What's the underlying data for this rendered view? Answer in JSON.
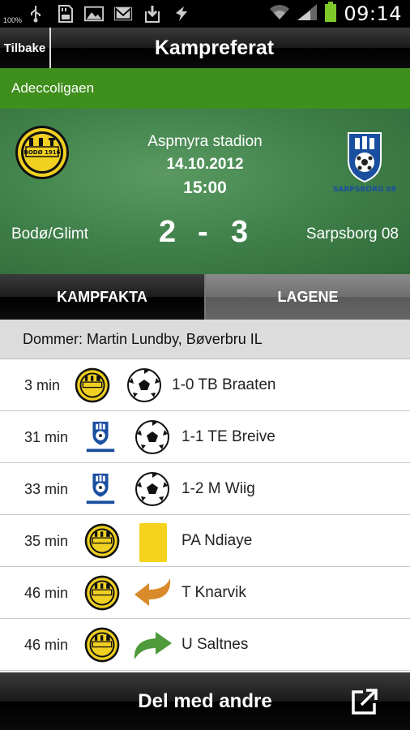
{
  "status_bar": {
    "battery_small_text": "100%",
    "time": "09:14",
    "icons": [
      "usb-icon",
      "sd-card-icon",
      "image-icon",
      "gmail-icon",
      "download-icon",
      "sync-icon",
      "wifi-icon",
      "signal-icon",
      "battery-icon"
    ]
  },
  "header": {
    "back_label": "Tilbake",
    "title": "Kampreferat"
  },
  "league": "Adeccoligaen",
  "match": {
    "venue": "Aspmyra stadion",
    "date": "14.10.2012",
    "time": "15:00",
    "home_team": "Bodø/Glimt",
    "away_team": "Sarpsborg 08",
    "home_score": "2",
    "separator": "-",
    "away_score": "3",
    "home_logo_text": "BODØ 1916",
    "away_logo_text": "SARPSBORG 08"
  },
  "tabs": [
    {
      "label": "KAMPFAKTA",
      "active": true
    },
    {
      "label": "LAGENE",
      "active": false
    }
  ],
  "referee": "Dommer: Martin Lundby, Bøverbru IL",
  "events": [
    {
      "minute": "3 min",
      "team": "home",
      "type": "goal",
      "text": "1-0 TB Braaten"
    },
    {
      "minute": "31 min",
      "team": "away",
      "type": "goal",
      "text": "1-1 TE Breive"
    },
    {
      "minute": "33 min",
      "team": "away",
      "type": "goal",
      "text": "1-2 M Wiig"
    },
    {
      "minute": "35 min",
      "team": "home",
      "type": "yellow-card",
      "text": "PA Ndiaye"
    },
    {
      "minute": "46 min",
      "team": "home",
      "type": "substitution-out",
      "text": "T Knarvik"
    },
    {
      "minute": "46 min",
      "team": "home",
      "type": "substitution-in",
      "text": "U Saltnes"
    }
  ],
  "footer": {
    "share_label": "Del med andre"
  },
  "colors": {
    "league_green": "#3f8f1c",
    "yellow_card": "#f5d21c",
    "sub_out_orange": "#d98a2a",
    "sub_in_green": "#4f9a3a",
    "bodo_yellow": "#f0d020",
    "sarpsborg_blue": "#1a4fa0"
  }
}
